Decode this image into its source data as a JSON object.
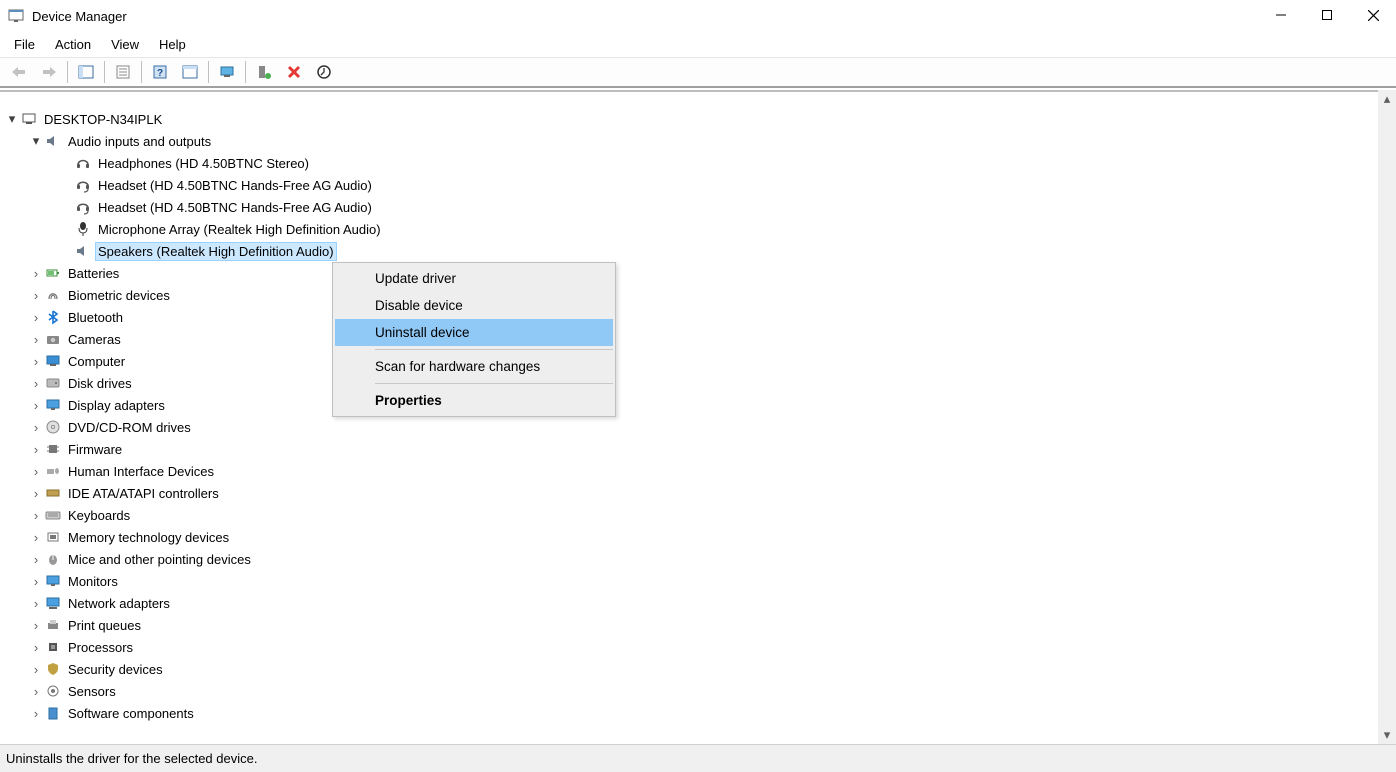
{
  "window": {
    "title": "Device Manager"
  },
  "menubar": {
    "file": "File",
    "action": "Action",
    "view": "View",
    "help": "Help"
  },
  "tree": {
    "root": "DESKTOP-N34IPLK",
    "audio_category": "Audio inputs and outputs",
    "audio_items": {
      "headphones": "Headphones (HD 4.50BTNC Stereo)",
      "headset1": "Headset (HD 4.50BTNC Hands-Free AG Audio)",
      "headset2": "Headset (HD 4.50BTNC Hands-Free AG Audio)",
      "micarray": "Microphone Array (Realtek High Definition Audio)",
      "speakers": "Speakers (Realtek High Definition Audio)"
    },
    "categories": {
      "batteries": "Batteries",
      "biometric": "Biometric devices",
      "bluetooth": "Bluetooth",
      "cameras": "Cameras",
      "computer": "Computer",
      "diskdrives": "Disk drives",
      "display": "Display adapters",
      "dvd": "DVD/CD-ROM drives",
      "firmware": "Firmware",
      "hid": "Human Interface Devices",
      "ide": "IDE ATA/ATAPI controllers",
      "keyboards": "Keyboards",
      "memtech": "Memory technology devices",
      "mice": "Mice and other pointing devices",
      "monitors": "Monitors",
      "network": "Network adapters",
      "printqueues": "Print queues",
      "processors": "Processors",
      "security": "Security devices",
      "sensors": "Sensors",
      "software": "Software components"
    }
  },
  "context_menu": {
    "update": "Update driver",
    "disable": "Disable device",
    "uninstall": "Uninstall device",
    "scan": "Scan for hardware changes",
    "properties": "Properties"
  },
  "statusbar": {
    "text": "Uninstalls the driver for the selected device."
  }
}
